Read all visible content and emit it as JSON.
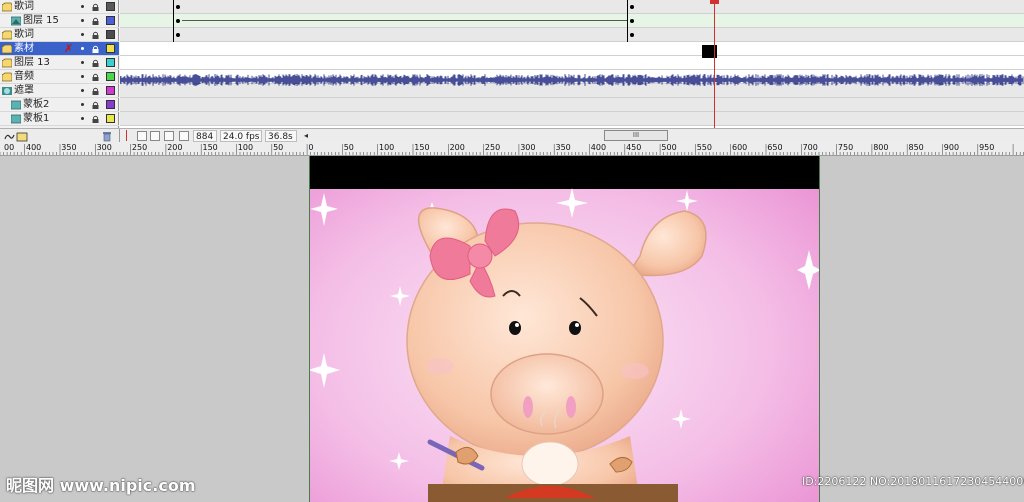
{
  "layers": [
    {
      "name": "歌词",
      "type": "folder",
      "color": "#5a5a5a"
    },
    {
      "name": "图层 15",
      "type": "layer",
      "color": "#4a5fd8"
    },
    {
      "name": "歌词",
      "type": "folder",
      "color": "#4c4c4c"
    },
    {
      "name": "素材",
      "type": "folder",
      "color": "#f0e04a",
      "selected": true
    },
    {
      "name": "图层 13",
      "type": "folder",
      "color": "#3ad0d0"
    },
    {
      "name": "音频",
      "type": "folder",
      "color": "#4ad84a"
    },
    {
      "name": "遮罩",
      "type": "mask",
      "color": "#d03ad0"
    },
    {
      "name": "蒙板2",
      "type": "masked",
      "color": "#8a3ad0"
    },
    {
      "name": "蒙板1",
      "type": "masked",
      "color": "#e8e84a"
    }
  ],
  "status": {
    "current_frame": "884",
    "frame_rate": "24.0 fps",
    "elapsed_time": "36.8s",
    "scroll_thumb_label": "III"
  },
  "ruler": {
    "labels": [
      "00",
      "400",
      "350",
      "300",
      "250",
      "200",
      "150",
      "100",
      "50",
      "0",
      "50",
      "100",
      "150",
      "200",
      "250",
      "300",
      "350",
      "400",
      "450",
      "500",
      "550",
      "600",
      "650",
      "700",
      "750",
      "800",
      "850",
      "900",
      "950"
    ]
  },
  "watermark": {
    "logo": "昵图网 www.nipic.com",
    "id_text": "ID:2206122 NO:20180116172304544000"
  },
  "colors": {
    "selection": "#3a62c9",
    "playhead": "#d03030",
    "waveform": "#1a237e",
    "stage_pink": "#f6c6ea"
  },
  "icons": {
    "add-layer": "add-layer-icon",
    "add-folder": "add-folder-icon",
    "delete": "trash-icon",
    "lock": "lock-icon",
    "eye": "eye-dot-icon"
  }
}
